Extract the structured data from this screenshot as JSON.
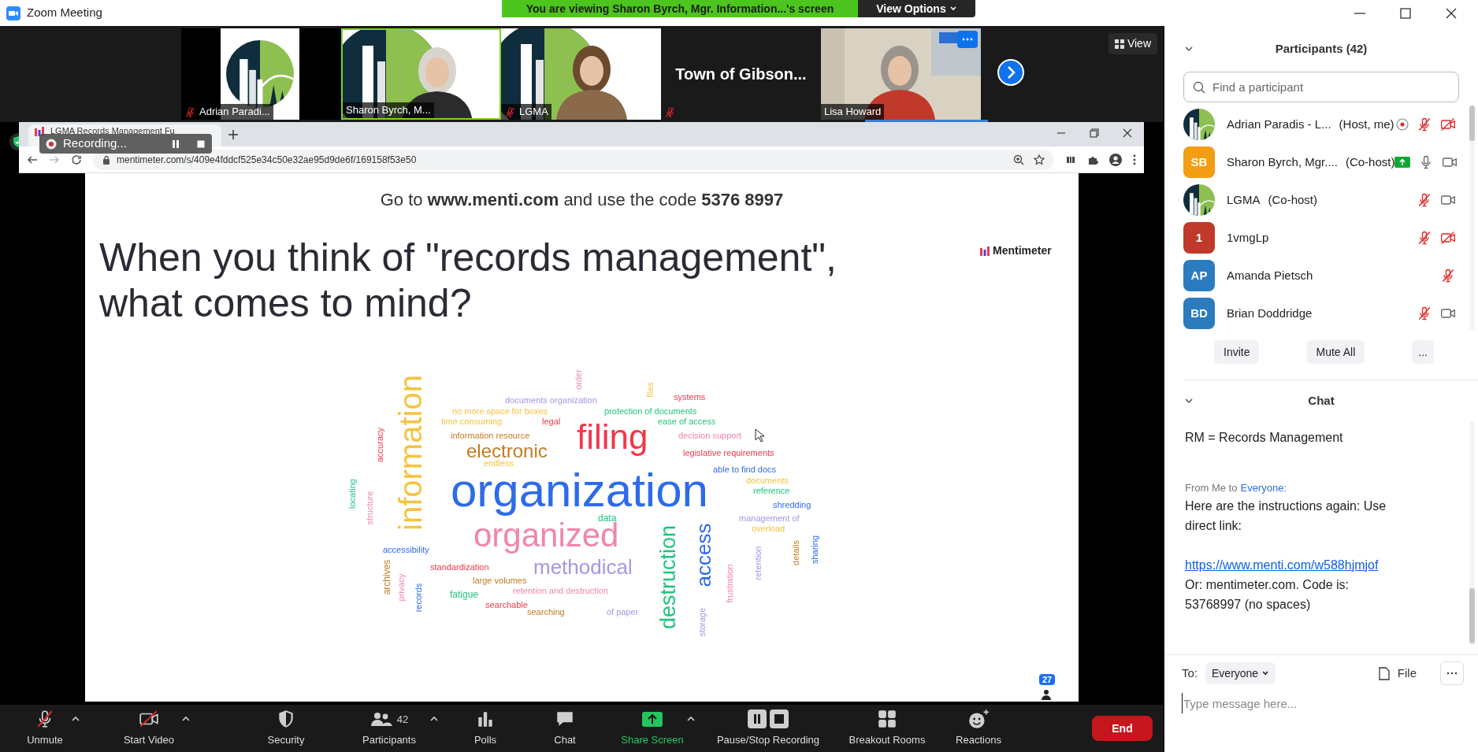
{
  "window": {
    "title": "Zoom Meeting"
  },
  "share_banner": {
    "text": "You are viewing Sharon Byrch, Mgr. Information...'s screen",
    "button": "View Options"
  },
  "thumbnails": [
    {
      "kind": "logo",
      "name": "Adrian Paradi...",
      "muted": true,
      "active": false,
      "menu": false
    },
    {
      "kind": "video",
      "name": "Sharon Byrch, M...",
      "muted": false,
      "active": true,
      "menu": false
    },
    {
      "kind": "video",
      "name": "LGMA",
      "muted": true,
      "active": false,
      "menu": false
    },
    {
      "kind": "text",
      "title": "Town of Gibson...",
      "muted": true,
      "active": false,
      "menu": false
    },
    {
      "kind": "video",
      "name": "Lisa Howard",
      "muted": false,
      "active": false,
      "menu": true
    }
  ],
  "view_button": "View",
  "browser": {
    "tab_title": "LGMA Records Management Fu",
    "url": "mentimeter.com/s/409e4fddcf525e34c50e32ae95d9de6f/169158f53e50"
  },
  "recording": {
    "label": "Recording..."
  },
  "slide": {
    "instruction": "Go to **www.menti.com** and use the code **5376 8997**",
    "question": "When you think of \"records management\", what comes to mind?",
    "brand": "Mentimeter",
    "audience_count": "27",
    "word_cloud": [
      {
        "text": "accuracy",
        "color": "#f0384a"
      },
      {
        "text": "locating",
        "color": "#1fc47e"
      },
      {
        "text": "structure",
        "color": "#f285ab"
      },
      {
        "text": "information",
        "color": "#f5c342"
      },
      {
        "text": "order",
        "color": "#f285ab"
      },
      {
        "text": "files",
        "color": "#f5c342"
      },
      {
        "text": "documents organization",
        "color": "#a299e6"
      },
      {
        "text": "systems",
        "color": "#f0384a"
      },
      {
        "text": "no more space for boxes",
        "color": "#f5c342"
      },
      {
        "text": "protection of documents",
        "color": "#1fc47e"
      },
      {
        "text": "time consuming",
        "color": "#f5c342"
      },
      {
        "text": "legal",
        "color": "#f0384a"
      },
      {
        "text": "ease of access",
        "color": "#1fc47e"
      },
      {
        "text": "information resource",
        "color": "#c27b1f"
      },
      {
        "text": "electronic",
        "color": "#c27b1f"
      },
      {
        "text": "filing",
        "color": "#f0384a"
      },
      {
        "text": "decision support",
        "color": "#f285ab"
      },
      {
        "text": "legislative requirements",
        "color": "#f0384a"
      },
      {
        "text": "endless",
        "color": "#f5c342"
      },
      {
        "text": "organization",
        "color": "#2d6bea"
      },
      {
        "text": "able to find docs",
        "color": "#2d6bea"
      },
      {
        "text": "documents",
        "color": "#f5c342"
      },
      {
        "text": "reference",
        "color": "#1fc47e"
      },
      {
        "text": "shredding",
        "color": "#2d6bea"
      },
      {
        "text": "data",
        "color": "#1fc47e"
      },
      {
        "text": "management of",
        "color": "#a299e6"
      },
      {
        "text": "accessibility",
        "color": "#2d6bea"
      },
      {
        "text": "organized",
        "color": "#f285ab"
      },
      {
        "text": "archives",
        "color": "#c27b1f"
      },
      {
        "text": "privacy",
        "color": "#f285ab"
      },
      {
        "text": "records",
        "color": "#2d6bea"
      },
      {
        "text": "standardization",
        "color": "#f0384a"
      },
      {
        "text": "methodical",
        "color": "#a299e6"
      },
      {
        "text": "large volumes",
        "color": "#c27b1f"
      },
      {
        "text": "fatigue",
        "color": "#1fc47e"
      },
      {
        "text": "retention and destruction",
        "color": "#f285ab"
      },
      {
        "text": "searchable",
        "color": "#f0384a"
      },
      {
        "text": "searching",
        "color": "#c27b1f"
      },
      {
        "text": "of paper",
        "color": "#a299e6"
      },
      {
        "text": "destruction",
        "color": "#1fc47e"
      },
      {
        "text": "access",
        "color": "#2d6bea"
      },
      {
        "text": "storage",
        "color": "#a299e6"
      },
      {
        "text": "frustration",
        "color": "#f285ab"
      },
      {
        "text": "overload",
        "color": "#f5c342"
      },
      {
        "text": "retention",
        "color": "#a299e6"
      },
      {
        "text": "details",
        "color": "#c27b1f"
      },
      {
        "text": "sharing",
        "color": "#2d6bea"
      }
    ]
  },
  "participants": {
    "title": "Participants (42)",
    "search_placeholder": "Find a participant",
    "rows": [
      {
        "kind": "logo",
        "name": "Adrian Paradis - L...",
        "role": "(Host, me)",
        "recording": true,
        "sharing": false,
        "muted": true,
        "video_off": true
      },
      {
        "kind": "initials",
        "initials": "SB",
        "color": "#f29d12",
        "name": "Sharon Byrch, Mgr....",
        "role": "(Co-host)",
        "recording": false,
        "sharing": true,
        "muted": false,
        "video_off": false
      },
      {
        "kind": "logo",
        "name": "LGMA",
        "role": "(Co-host)",
        "recording": false,
        "sharing": false,
        "muted": true,
        "video_off": false
      },
      {
        "kind": "initials",
        "initials": "1",
        "color": "#c0392b",
        "name": "1vmgLp",
        "recording": false,
        "sharing": false,
        "muted": true,
        "video_off": true
      },
      {
        "kind": "initials",
        "initials": "AP",
        "color": "#2b7bbf",
        "name": "Amanda Pietsch",
        "recording": false,
        "sharing": false,
        "muted": true
      },
      {
        "kind": "initials",
        "initials": "BD",
        "color": "#2b7bbf",
        "name": "Brian Doddridge",
        "recording": false,
        "sharing": false,
        "muted": true,
        "video_off": false
      }
    ],
    "buttons": [
      "Invite",
      "Mute All",
      "..."
    ]
  },
  "chat": {
    "title": "Chat",
    "messages": [
      {
        "kind": "text",
        "text": "RM = Records Management"
      },
      {
        "kind": "sender",
        "prefix": "From Me to",
        "recipient": "Everyone:"
      },
      {
        "kind": "text",
        "text": "Here are the instructions again: Use direct link:"
      },
      {
        "kind": "link",
        "text": "https://www.menti.com/w588hjmjof"
      },
      {
        "kind": "text",
        "text": "Or: mentimeter.com. Code is: 53768997 (no spaces)"
      }
    ],
    "to_label": "To:",
    "recipient": "Everyone",
    "file_button": "File",
    "input_placeholder": "Type message here..."
  },
  "toolbar": {
    "items": [
      {
        "kind": "mic_off",
        "label": "Unmute",
        "menu": true
      },
      {
        "kind": "video_off",
        "label": "Start Video",
        "menu": true
      },
      {
        "kind": "security",
        "label": "Security",
        "menu": false
      },
      {
        "kind": "participants",
        "label": "Participants",
        "count": "42",
        "menu": true
      },
      {
        "kind": "polls",
        "label": "Polls",
        "menu": false
      },
      {
        "kind": "chat",
        "label": "Chat",
        "menu": false
      },
      {
        "kind": "share",
        "label": "Share Screen",
        "menu": true
      },
      {
        "kind": "recording",
        "label": "Pause/Stop Recording",
        "menu": false
      },
      {
        "kind": "breakout",
        "label": "Breakout Rooms",
        "menu": false
      },
      {
        "kind": "reactions",
        "label": "Reactions",
        "menu": false
      }
    ],
    "end_button": "End"
  }
}
